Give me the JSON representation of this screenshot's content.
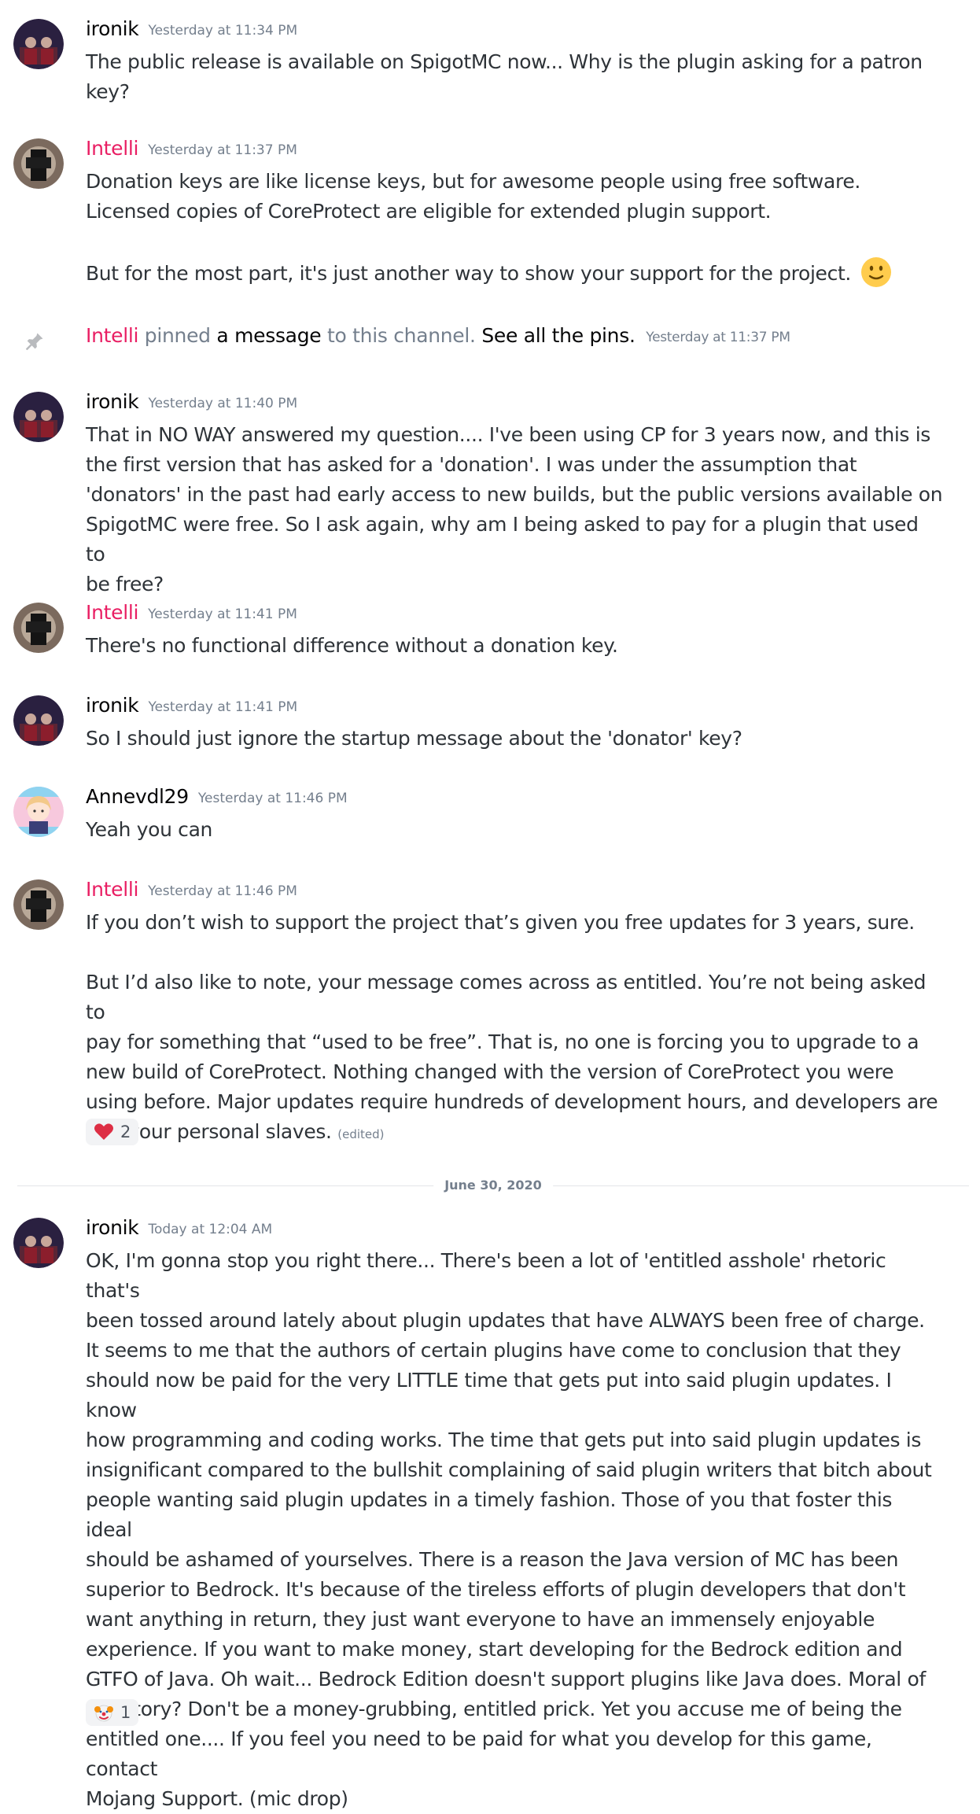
{
  "colors": {
    "ironik": "#060607",
    "intelli": "#e91e63",
    "annevdl29": "#060607",
    "text": "#2e3338",
    "muted": "#747f8d"
  },
  "users": {
    "ironik": "ironik",
    "intelli": "Intelli",
    "annevdl29": "Annevdl29"
  },
  "messages": [
    {
      "ts": "Yesterday at 11:34 PM",
      "lines": [
        "The public release is available on SpigotMC now... Why is the plugin asking for a patron",
        "key?"
      ]
    },
    {
      "ts": "Yesterday at 11:37 PM",
      "lines": [
        "Donation keys are like license keys, but for awesome people using free software.",
        "Licensed copies of CoreProtect are eligible for extended plugin support."
      ],
      "line2": "But for the most part, it's just another way to show your support for the project.",
      "emoji": "slight-smile-emoji"
    },
    {
      "ts": "Yesterday at 11:40 PM",
      "lines": [
        "That in NO WAY answered my question.... I've been using CP for 3 years now, and this is",
        "the first version that has asked for a 'donation'. I was under the assumption that",
        "'donators' in the past had early access to new builds, but the public versions available on",
        "SpigotMC were free. So I ask again, why am I being asked to pay for a plugin that used to",
        "be free?"
      ]
    },
    {
      "ts": "Yesterday at 11:41 PM",
      "lines": [
        "There's no functional difference without a donation key."
      ]
    },
    {
      "ts": "Yesterday at 11:41 PM",
      "lines": [
        "So I should just ignore the startup message about the 'donator' key?"
      ]
    },
    {
      "ts": "Yesterday at 11:46 PM",
      "lines": [
        "Yeah you can"
      ]
    },
    {
      "ts": "Yesterday at 11:46 PM",
      "first": "If you don’t wish to support the project that’s given you free updates for 3 years, sure.",
      "lines": [
        "But I’d also like to note, your message comes across as entitled. You’re not being asked to",
        "pay for something that “used to be free”. That is, no one is forcing you to upgrade to a",
        "new build of CoreProtect. Nothing changed with the version of CoreProtect you were",
        "using before. Major updates require hundreds of development hours, and developers are"
      ],
      "bold_word": "not",
      "tail": " your personal slaves.",
      "edited": "(edited)",
      "reaction": {
        "icon": "heart-emoji",
        "count": "2"
      }
    },
    {
      "ts": "Today at 12:04 AM",
      "lines": [
        "OK, I'm gonna stop you right there... There's been a lot of 'entitled asshole' rhetoric that's",
        "been tossed around lately about plugin updates that have ALWAYS been free of charge.",
        "It seems to me that the authors of certain plugins have come to conclusion that they",
        "should now be paid for the very LITTLE time that gets put into said plugin updates. I know",
        "how programming and coding works. The time that gets put into said plugin updates is",
        "insignificant compared to the bullshit complaining of said plugin writers that bitch about",
        "people wanting said plugin updates in a timely fashion. Those of you that foster this ideal",
        "should be ashamed of yourselves. There is a reason the Java version of MC has been",
        "superior to Bedrock. It's because of the tireless efforts of plugin developers that don't",
        "want anything in return, they just want everyone to have an immensely enjoyable",
        "experience. If you want to make money, start developing for the Bedrock edition and",
        "GTFO of Java. Oh wait... Bedrock Edition doesn't support plugins like Java does. Moral of",
        "the story? Don't be a money-grubbing, entitled prick. Yet you accuse me of being the",
        "entitled one.... If you feel you need to be paid for what you develop for this game, contact",
        "Mojang Support. (mic drop)"
      ],
      "reaction": {
        "icon": "clown-emoji",
        "count": "1"
      }
    }
  ],
  "system": {
    "user": "Intelli",
    "pinned": "pinned",
    "a_message": "a message",
    "to_channel": "to this channel.",
    "see_pins": "See all the pins.",
    "ts": "Yesterday at 11:37 PM",
    "icon": "pin-icon"
  },
  "divider": "June 30, 2020"
}
